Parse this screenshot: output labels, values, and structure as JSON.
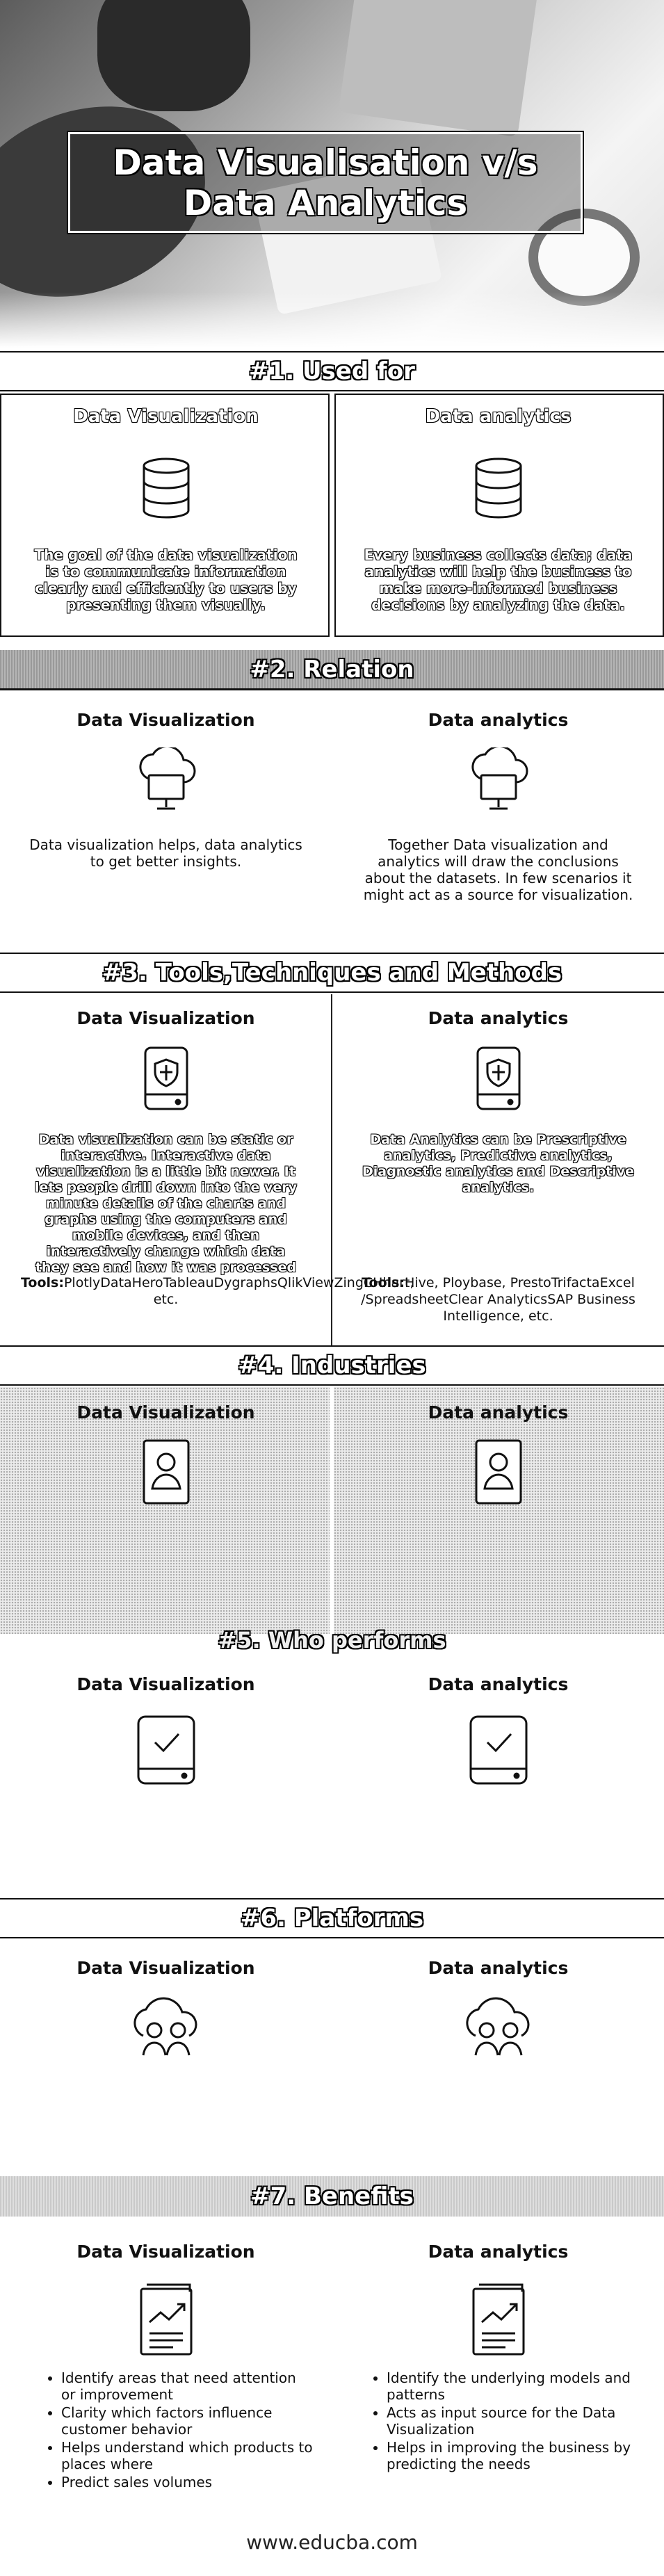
{
  "hero": {
    "title_line1": "Data Visualisation v/s",
    "title_line2": "Data Analytics"
  },
  "columns": {
    "left": "Data Visualization",
    "right": "Data analytics"
  },
  "used_for": {
    "header": "#1. Used for",
    "left_text": "The goal of the data visualization is to communicate information clearly and efficiently to users by presenting them visually.",
    "right_text": "Every business collects data; data analytics will help the business to make more-informed business decisions by analyzing the data."
  },
  "relation": {
    "header": "#2. Relation",
    "left_text": "Data visualization helps, data analytics to get better insights.",
    "right_text": "Together Data visualization and analytics will draw the conclusions about the datasets. In few scenarios it might act as a source for visualization."
  },
  "tools": {
    "header": "#3. Tools,Techniques and Methods",
    "left_text": "Data visualization can be static or interactive. Interactive data visualization is a little bit newer. It lets people drill down into the very minute details of the charts and graphs using the computers and mobile devices, and then interactively change which data they see and how it was processed",
    "right_text": "Data Analytics can be Prescriptive analytics, Predictive analytics, Diagnostic analytics and Descriptive analytics.",
    "label": "Tools:",
    "left_tools": "PlotlyDataHeroTableauDygraphsQlikViewZingCHhart, etc.",
    "right_tools": "Hive, Ploybase, PrestoTrifactaExcel /SpreadsheetClear AnalyticsSAP Business Intelligence, etc."
  },
  "industries": {
    "header": "#4. Industries"
  },
  "who": {
    "header": "#5. Who performs"
  },
  "platforms": {
    "header": "#6. Platforms"
  },
  "benefits": {
    "header": "#7. Benefits",
    "left": [
      "Identify areas that need attention or improvement",
      "Clarity which factors influence customer behavior",
      "Helps understand which products to places where",
      "Predict sales volumes"
    ],
    "right": [
      "Identify the underlying models and patterns",
      "Acts as input source for the Data Visualization",
      "Helps in improving the business by predicting the needs"
    ]
  },
  "footer": {
    "url": "www.educba.com"
  },
  "icons": [
    "database-icon",
    "cloud-monitor-icon",
    "shield-drive-icon",
    "user-card-icon",
    "check-drive-icon",
    "cloud-people-icon",
    "chart-document-icon"
  ]
}
